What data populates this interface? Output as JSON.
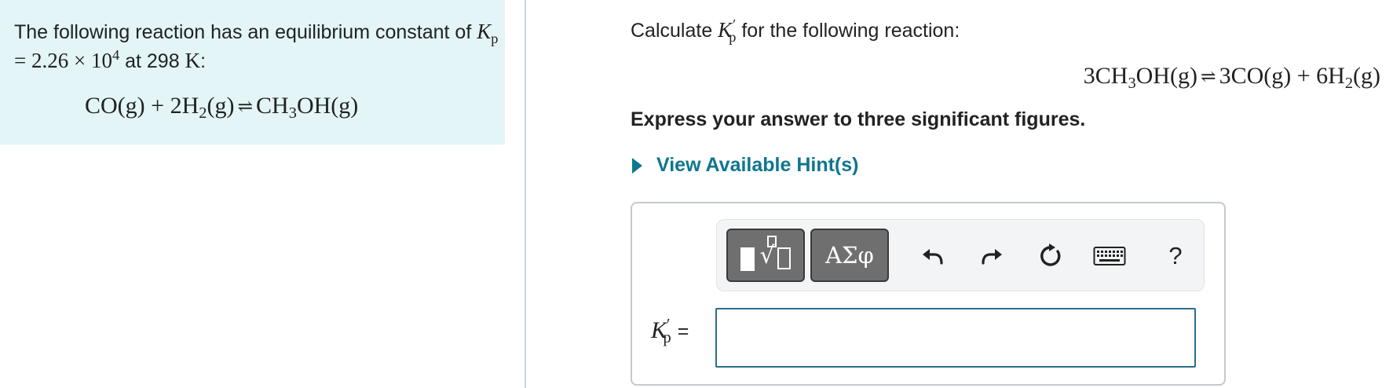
{
  "left_panel": {
    "intro_part1": "The following reaction has an equilibrium constant of ",
    "kp_symbol": "K",
    "kp_sub": "p",
    "kp_equals": " = 2.26 × 10",
    "kp_exp": "4",
    "at_text": " at 298 ",
    "temp_unit": "K",
    "colon": ":",
    "equation": {
      "reactant_1": "CO(g) + 2H",
      "reactant_1_sub": "2",
      "reactant_1_tail": "(g)",
      "arrow": "⇌",
      "product_1": "CH",
      "product_1_sub": "3",
      "product_1_tail": "OH(g)"
    }
  },
  "right_panel": {
    "question_prefix": "Calculate ",
    "k_symbol": "K",
    "k_prime": "′",
    "k_sub": "p",
    "question_suffix": " for the following reaction:",
    "equation": {
      "reactant": "3CH",
      "reactant_sub": "3",
      "reactant_tail": "OH(g)",
      "arrow": "⇌",
      "product_1": "3CO(g) + 6H",
      "product_1_sub": "2",
      "product_1_tail": "(g)"
    },
    "instruction": "Express your answer to three significant figures.",
    "hint_label": "View Available Hint(s)"
  },
  "answer": {
    "toolbar": {
      "templates_icon": "templates-icon",
      "greek_label": "ΑΣφ",
      "undo_icon": "undo-icon",
      "redo_icon": "redo-icon",
      "reset_icon": "reset-icon",
      "keyboard_icon": "keyboard-icon",
      "help_label": "?"
    },
    "label_symbol": "K",
    "label_prime": "′",
    "label_sub": "p",
    "label_equals": "=",
    "input_value": ""
  },
  "colors": {
    "panel_bg": "#e3f5f6",
    "hint_color": "#0f7690",
    "input_border": "#2b6e8c",
    "toolbar_button": "#6f6f6f"
  }
}
